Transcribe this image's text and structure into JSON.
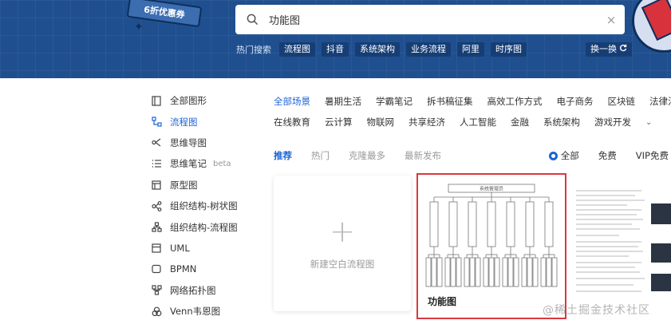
{
  "promo": {
    "tag": "6折优惠券"
  },
  "search": {
    "value": "功能图",
    "placeholder": "",
    "clear_icon": "×"
  },
  "hot": {
    "label": "热门搜索",
    "chips": [
      "流程图",
      "抖音",
      "系统架构",
      "业务流程",
      "阿里",
      "时序图"
    ],
    "swap_label": "换一换"
  },
  "sidebar": {
    "items": [
      {
        "label": "全部图形",
        "icon": "doc-icon"
      },
      {
        "label": "流程图",
        "icon": "flowchart-icon",
        "active": true
      },
      {
        "label": "思维导图",
        "icon": "mindmap-icon"
      },
      {
        "label": "思维笔记",
        "icon": "list-icon",
        "badge": "beta"
      },
      {
        "label": "原型图",
        "icon": "prototype-icon"
      },
      {
        "label": "组织结构-树状图",
        "icon": "org-tree-icon"
      },
      {
        "label": "组织结构-流程图",
        "icon": "org-flow-icon"
      },
      {
        "label": "UML",
        "icon": "uml-icon"
      },
      {
        "label": "BPMN",
        "icon": "bpmn-icon"
      },
      {
        "label": "网络拓扑图",
        "icon": "network-icon"
      },
      {
        "label": "Venn韦恩图",
        "icon": "venn-icon"
      }
    ]
  },
  "categories": {
    "row1": [
      "全部场景",
      "暑期生活",
      "学霸笔记",
      "拆书稿征集",
      "高效工作方式",
      "电子商务",
      "区块链",
      "法律法务"
    ],
    "row2": [
      "在线教育",
      "云计算",
      "物联网",
      "共享经济",
      "人工智能",
      "金融",
      "系统架构",
      "游戏开发"
    ],
    "more_icon": "⌄"
  },
  "filters": {
    "sorts": [
      "推荐",
      "热门",
      "克隆最多",
      "最新发布"
    ],
    "prices": [
      "全部",
      "免费",
      "VIP免费"
    ]
  },
  "cards": {
    "new_label": "新建空白流程图",
    "plus": "+",
    "func_title": "功能图",
    "func_root": "系统管理员"
  },
  "watermark": "@稀土掘金技术社区",
  "colors": {
    "banner": "#1f4f8e",
    "accent": "#1b63d6",
    "highlight_border": "#d9383f"
  }
}
